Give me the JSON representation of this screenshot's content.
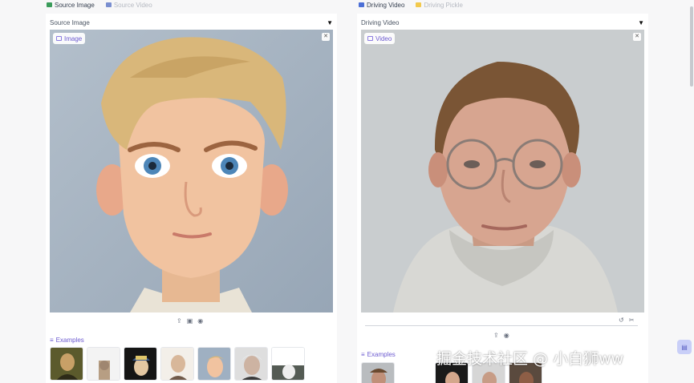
{
  "left_tabs": [
    {
      "label": "Source Image",
      "active": true,
      "icon": "image-icon"
    },
    {
      "label": "Source Video",
      "active": false,
      "icon": "video-icon"
    }
  ],
  "right_tabs": [
    {
      "label": "Driving Video",
      "active": true,
      "icon": "video-icon"
    },
    {
      "label": "Driving Pickle",
      "active": false,
      "icon": "folder-icon"
    }
  ],
  "source_panel": {
    "title": "Source Image",
    "badge": "Image",
    "examples_label": "Examples"
  },
  "driving_panel": {
    "title": "Driving Video",
    "badge": "Video",
    "examples_label": "Examples"
  },
  "watermark": "掘金技术社区 @ 小白狮ww",
  "colors": {
    "accent": "#6d5bd0",
    "source_bg": "#a7b4c2",
    "driving_bg": "#c8cdd0"
  }
}
